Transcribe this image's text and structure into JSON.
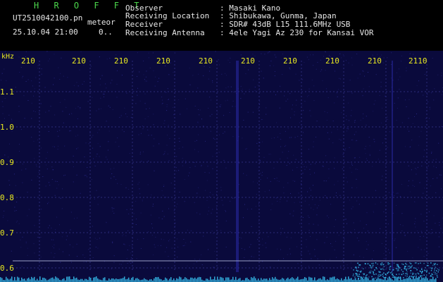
{
  "header": {
    "title": "H R O F F T",
    "filename": "UT2510042100.pn",
    "mode": "meteor",
    "datetime": "25.10.04 21:00",
    "counter": "0..",
    "observer_label": "Observer",
    "observer_value": ": Masaki Kano",
    "location_label": "Receiving Location",
    "location_value": ": Shibukawa, Gunma, Japan",
    "receiver_label": "Receiver",
    "receiver_value": ": SDR# 43dB L15 111.6MHz USB",
    "antenna_label": "Receiving Antenna",
    "antenna_value": ": 4ele Yagi Az 230 for Kansai VOR"
  },
  "axis": {
    "unit": "kHz",
    "y_ticks": [
      "1.1",
      "1.0",
      "0.9",
      "0.8",
      "0.7",
      "0.6"
    ],
    "x_ticks": [
      "210",
      "210",
      "210",
      "210",
      "210",
      "210",
      "210",
      "210",
      "210",
      "2110"
    ]
  },
  "colors": {
    "background": "#0a0a3c",
    "grid": "#2a2a78",
    "noise": "#3a3ab0",
    "signal": "#3ad0ff",
    "baseline": "#9aa0c8"
  }
}
